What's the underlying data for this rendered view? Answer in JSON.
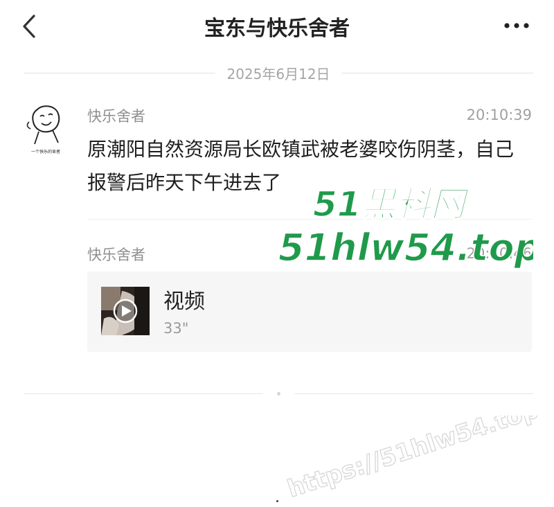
{
  "header": {
    "title": "宝东与快乐舍者",
    "back_icon": "chevron-left-icon",
    "more_icon": "more-dots-icon"
  },
  "date_divider": {
    "label": "2025年6月12日"
  },
  "messages": [
    {
      "sender": "快乐舍者",
      "time": "20:10:39",
      "text": "原潮阳自然资源局长欧镇武被老婆咬伤阴茎，自己报警后昨天下午进去了",
      "avatar_caption": "一个快乐的舍者"
    },
    {
      "sender": "快乐舍者",
      "time": "20:10:46",
      "video": {
        "title": "视频",
        "duration": "33\"",
        "play_icon": "play-icon"
      }
    }
  ],
  "watermark": {
    "line1": "51黑料网",
    "line2": "51hlw54.top",
    "diagonal": "https://51hlw54.top",
    "color": "#1f9a4b"
  }
}
